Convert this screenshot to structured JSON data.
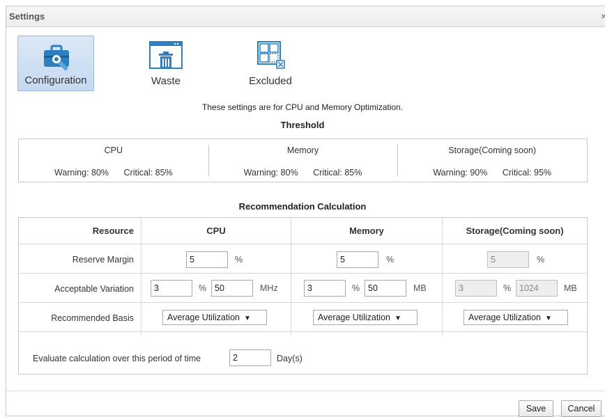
{
  "dialog": {
    "title": "Settings",
    "close_label": "×"
  },
  "tabs": [
    {
      "label": "Configuration",
      "icon": "toolbox-icon",
      "active": true
    },
    {
      "label": "Waste",
      "icon": "trash-window-icon",
      "active": false
    },
    {
      "label": "Excluded",
      "icon": "excluded-grid-icon",
      "active": false
    }
  ],
  "subtitle": "These settings are for CPU and Memory Optimization.",
  "threshold": {
    "title": "Threshold",
    "columns": [
      {
        "name": "CPU",
        "warning": "Warning: 80%",
        "critical": "Critical: 85%"
      },
      {
        "name": "Memory",
        "warning": "Warning: 80%",
        "critical": "Critical: 85%"
      },
      {
        "name": "Storage(Coming soon)",
        "warning": "Warning: 90%",
        "critical": "Critical: 95%"
      }
    ]
  },
  "recommendation": {
    "title": "Recommendation Calculation",
    "headers": {
      "resource": "Resource",
      "cpu": "CPU",
      "memory": "Memory",
      "storage": "Storage(Coming soon)"
    },
    "rows": {
      "reserve_margin": {
        "label": "Reserve Margin",
        "cpu": "5",
        "memory": "5",
        "storage": "5",
        "unit": "%"
      },
      "acceptable_variation": {
        "label": "Acceptable Variation",
        "cpu_pct": "3",
        "cpu_val": "50",
        "cpu_unit": "MHz",
        "memory_pct": "3",
        "memory_val": "50",
        "memory_unit": "MB",
        "storage_pct": "3",
        "storage_val": "1024",
        "storage_unit": "MB",
        "pct_unit": "%"
      },
      "recommended_basis": {
        "label": "Recommended Basis",
        "cpu": "Average Utilization",
        "memory": "Average Utilization",
        "storage": "Average Utilization",
        "caret": "▼"
      }
    },
    "evaluate": {
      "label": "Evaluate calculation over this period of time",
      "value": "2",
      "unit": "Day(s)"
    }
  },
  "footer": {
    "save_label": "Save",
    "cancel_label": "Cancel"
  }
}
